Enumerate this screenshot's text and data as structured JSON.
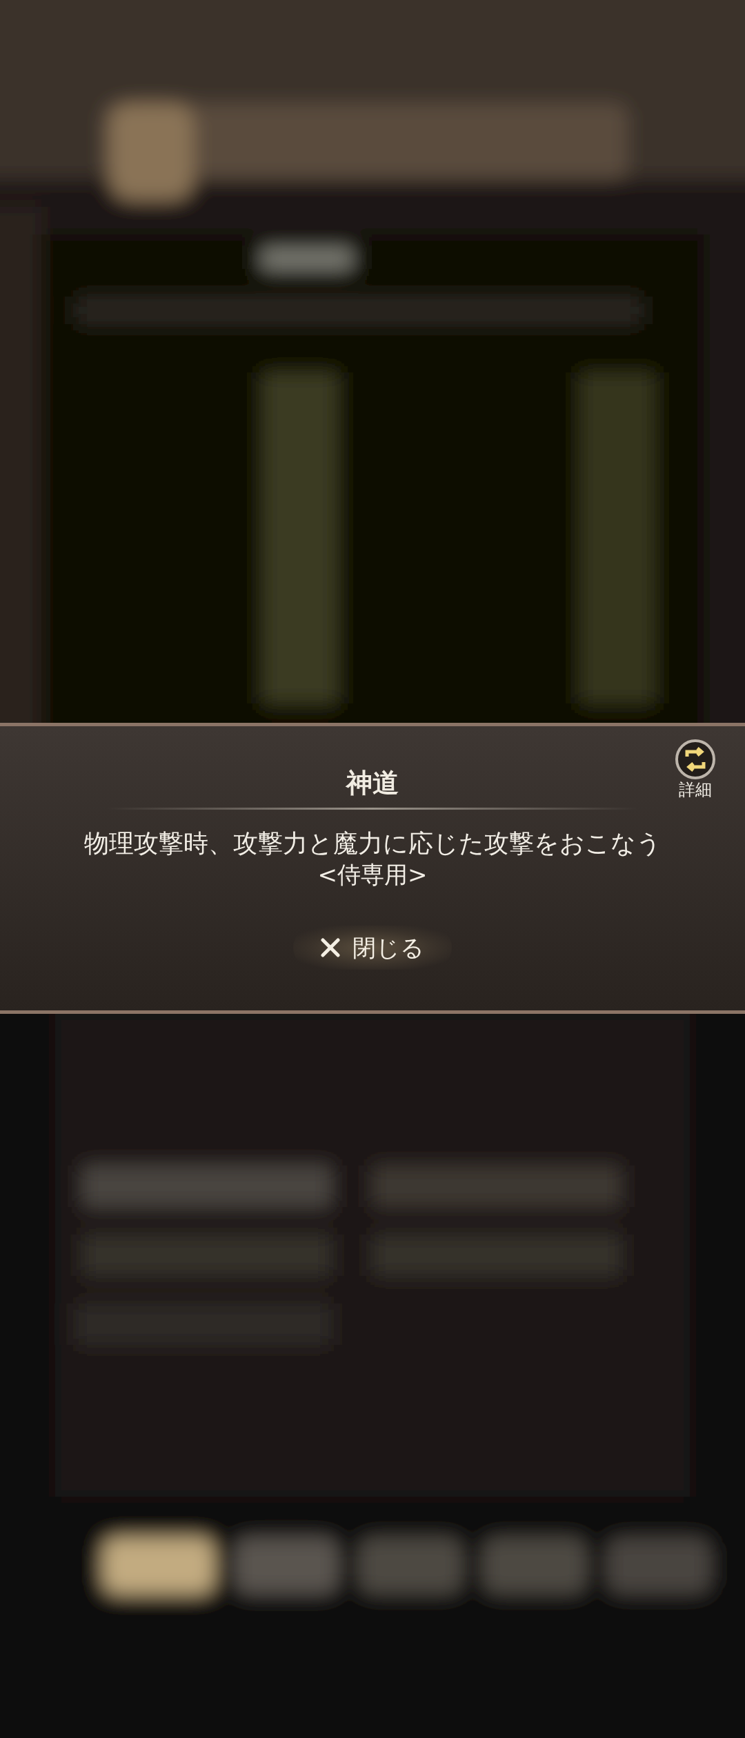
{
  "dialog": {
    "title": "神道",
    "description": "物理攻撃時、攻撃力と魔力に応じた攻撃をおこなう",
    "note": "<侍専用>",
    "detail_button": {
      "label": "詳細"
    },
    "close_button": {
      "label": "閉じる"
    }
  }
}
